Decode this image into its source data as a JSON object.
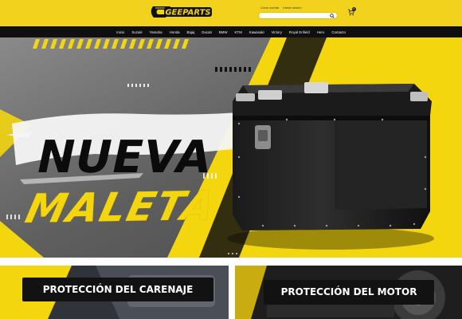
{
  "header": {
    "brand": "GEEPARTS",
    "account_links": [
      "Crear cuenta",
      "Iniciar sesión"
    ],
    "search": {
      "placeholder": "",
      "value": ""
    },
    "cart": {
      "count": "0"
    },
    "colors": {
      "header_bg": "#f2d21c",
      "nav_bg": "#0f0f0f",
      "brand_yellow": "#f3d60e"
    }
  },
  "nav": {
    "items": [
      "Inicio",
      "Suzuki",
      "Yamaha",
      "Honda",
      "Bajaj",
      "Ducati",
      "BMW",
      "KTM",
      "Kawasaki",
      "Victory",
      "Royal Enfield",
      "Hero",
      "Contacto"
    ]
  },
  "hero": {
    "title_line_1": "NUEVA",
    "title_line_2": "MALETA",
    "slides_indicator": 3
  },
  "categories": [
    {
      "label": "PROTECCIÓN  DEL CARENAJE"
    },
    {
      "label": "PROTECCIÓN DEL MOTOR"
    }
  ],
  "icons": [
    "logo-helmet-icon",
    "search-icon",
    "cart-icon"
  ]
}
